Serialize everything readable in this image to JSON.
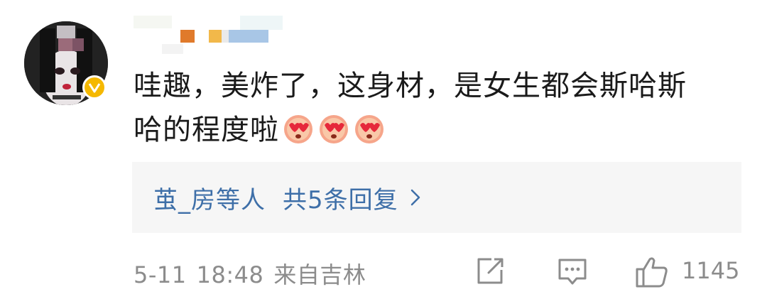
{
  "comment": {
    "text_line1": "哇趣，美炸了，这身材，是女生都会斯哈斯",
    "text_line2": "哈的程度啦",
    "emoji_name": "heart-eyes-emoji",
    "emoji_count": 3,
    "verified_badge": "V",
    "replies": {
      "names": "茧_房等人",
      "summary": "共5条回复",
      "chevron": ">"
    },
    "footer": {
      "date": "5-11",
      "time": "18:48",
      "location": "来自吉林",
      "like_count": "1145"
    }
  },
  "colors": {
    "link": "#3e6fa8",
    "meta": "#8c8c8c",
    "reply_bg": "#f6f6f6",
    "verified": "#f5b800"
  },
  "icons": [
    "share-icon",
    "comment-icon",
    "like-icon",
    "chevron-right-icon",
    "verified-icon"
  ]
}
